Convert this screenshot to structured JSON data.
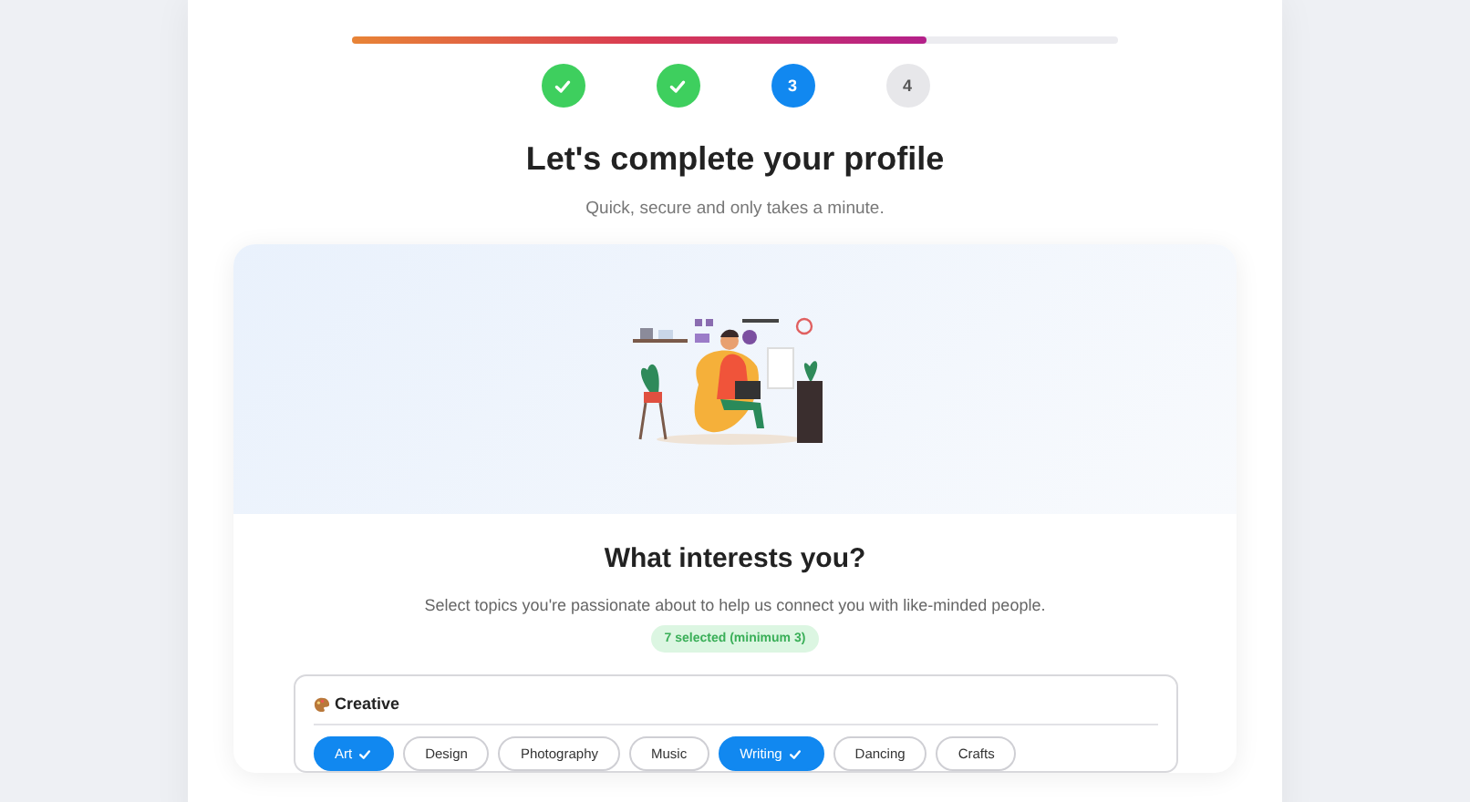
{
  "progress": {
    "level": 0.75
  },
  "steps": [
    {
      "kind": "complete"
    },
    {
      "kind": "complete"
    },
    {
      "kind": "current",
      "label": "3"
    },
    {
      "kind": "upcoming",
      "label": "4"
    }
  ],
  "title": "Let's complete your profile",
  "subtitle": "Quick, secure and only takes a minute.",
  "section": {
    "heading": "What interests you?",
    "description": "Select topics you're passionate about to help us connect you with like-minded people.",
    "badge": "7 selected (minimum 3)"
  },
  "category": {
    "name": "Creative",
    "topics": [
      {
        "label": "Art",
        "selected": true
      },
      {
        "label": "Design",
        "selected": false
      },
      {
        "label": "Photography",
        "selected": false
      },
      {
        "label": "Music",
        "selected": false
      },
      {
        "label": "Writing",
        "selected": true
      },
      {
        "label": "Dancing",
        "selected": false
      },
      {
        "label": "Crafts",
        "selected": false
      }
    ]
  }
}
